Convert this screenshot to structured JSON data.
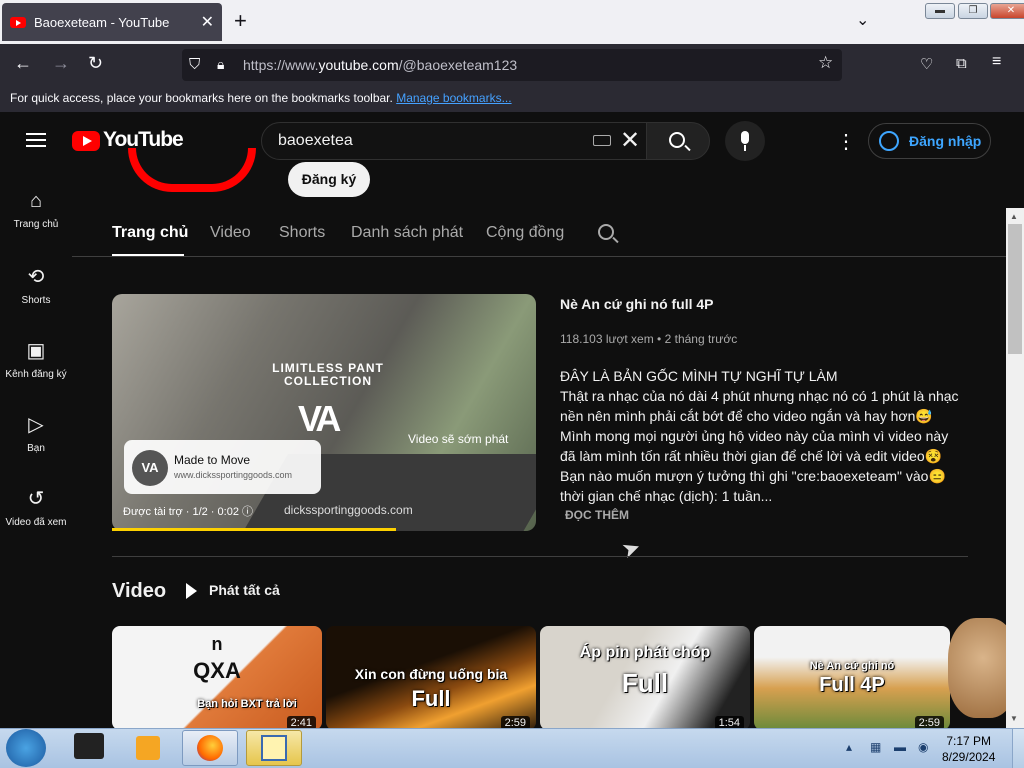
{
  "browser": {
    "tab_title": "Baoexeteam - YouTube",
    "url_prefix": "https://www.",
    "url_host": "youtube.com",
    "url_path": "/@baoexeteam123",
    "bookmarks_hint": "For quick access, place your bookmarks here on the bookmarks toolbar.",
    "bookmarks_link": "Manage bookmarks..."
  },
  "header": {
    "logo": "YouTube",
    "search_value": "baoexetea",
    "signin": "Đăng nhập"
  },
  "sidebar": {
    "items": [
      {
        "icon": "home-icon",
        "label": "Trang chủ"
      },
      {
        "icon": "shorts-icon",
        "label": "Shorts"
      },
      {
        "icon": "subscriptions-icon",
        "label": "Kênh đăng ký"
      },
      {
        "icon": "you-icon",
        "label": "Bạn"
      },
      {
        "icon": "history-icon",
        "label": "Video đã xem"
      }
    ]
  },
  "channel": {
    "subscribe": "Đăng ký",
    "tabs": [
      "Trang chủ",
      "Video",
      "Shorts",
      "Danh sách phát",
      "Cộng đồng"
    ]
  },
  "featured": {
    "overlay_brand": "LIMITLESS PANT COLLECTION",
    "overlay_soon": "Video sẽ sớm phát",
    "ad_title": "Made to Move",
    "ad_url": "www.dickssportinggoods.com",
    "ad_sponsor": "Được tài trợ · 1/2 · 0:02 ⓘ",
    "ad_domain": "dickssportinggoods.com",
    "ad_progress": 0.67,
    "title": "Nè An cứ ghi nó full 4P",
    "meta": "118.103 lượt xem • 2 tháng trước",
    "description": "ĐÂY LÀ BẢN GỐC MÌNH TỰ NGHĨ TỰ LÀM\nThật ra nhạc của nó dài 4 phút nhưng nhạc nó có 1 phút là nhạc nền nên mình phải cắt bớt để cho video ngắn và hay hơn😅\nMình mong mọi người ủng hộ video này của mình vì video này đã làm mình tốn rất nhiều thời gian để chế lời và edit video😵\nBạn nào muốn mượn ý tưởng thì ghi \"cre:baoexeteam\" vào😑\n thời gian chế nhạc (dịch): 1 tuần...",
    "read_more": "ĐỌC THÊM"
  },
  "videos": {
    "title": "Video",
    "play_all": "Phát tất cả",
    "items": [
      {
        "caption_top": "n",
        "caption_mid": "QXA",
        "caption": "Bạn hỏi BXT trả lời",
        "duration": "2:41"
      },
      {
        "caption": "Xin con đừng uống bia",
        "caption_big": "Full",
        "duration": "2:59"
      },
      {
        "caption": "Áp pin phát chóp",
        "caption_big": "Full",
        "duration": "1:54"
      },
      {
        "caption": "Nè An cứ ghi nó",
        "caption_big": "Full 4P",
        "duration": "2:59"
      }
    ]
  },
  "taskbar": {
    "time": "7:17 PM",
    "date": "8/29/2024"
  }
}
